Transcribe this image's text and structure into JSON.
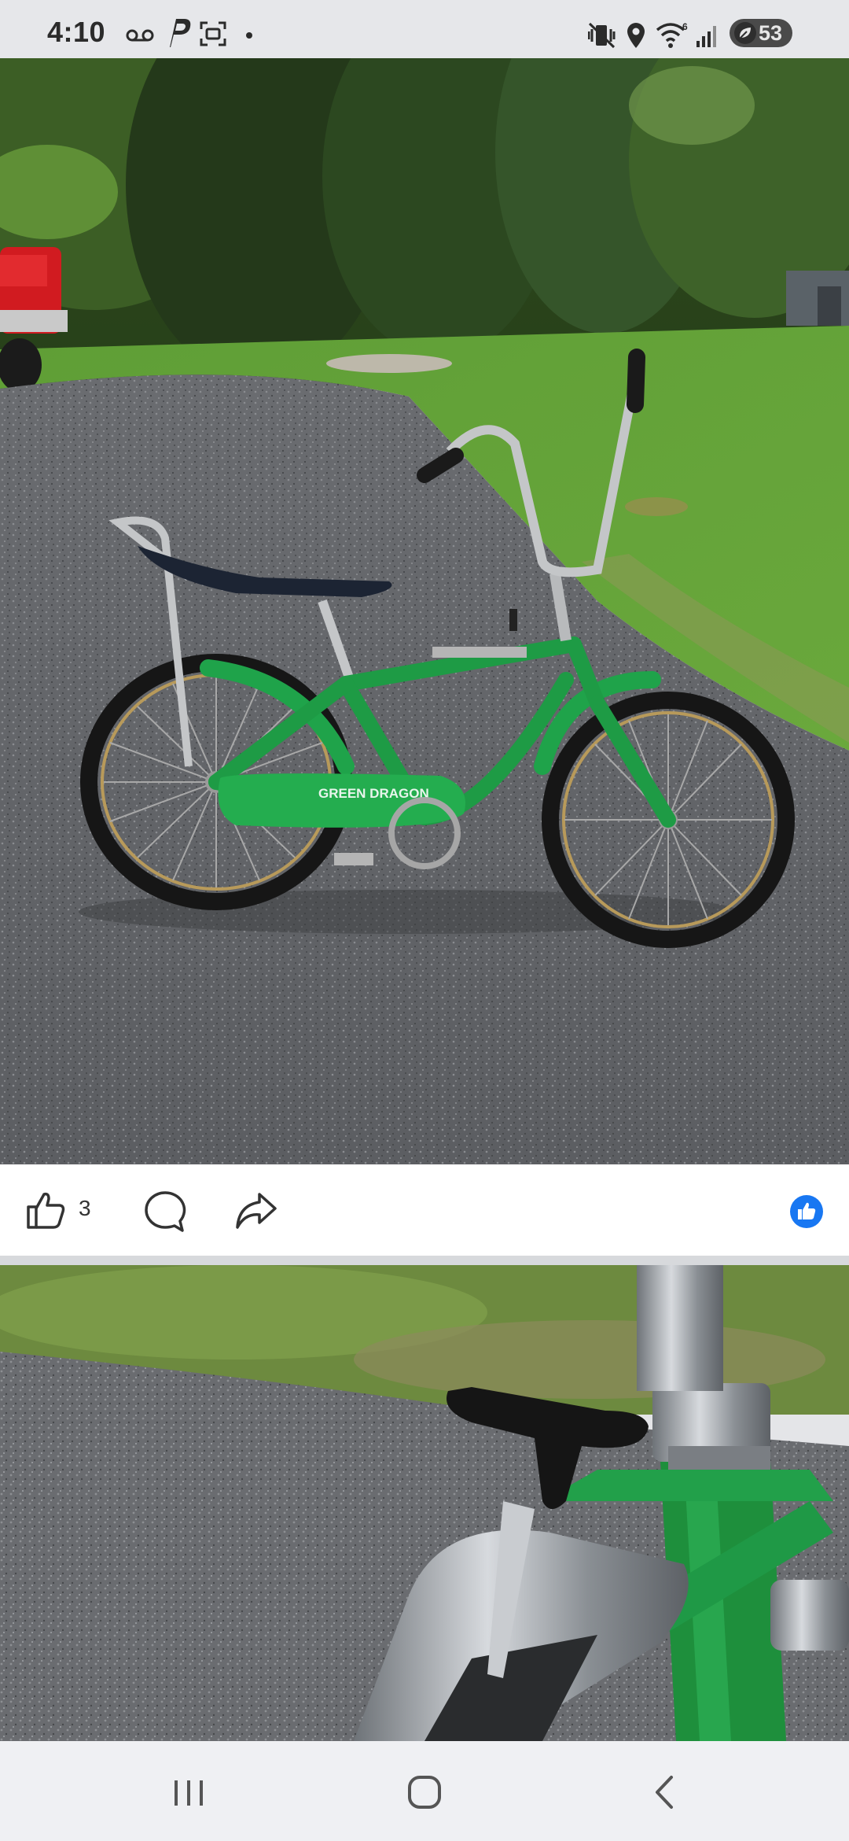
{
  "status_bar": {
    "time": "4:10",
    "left_icons": [
      "voicemail-icon",
      "parking-app-icon",
      "screenshot-icon",
      "dot-icon"
    ],
    "right_icons": [
      "vibrate-mute-icon",
      "location-icon",
      "wifi-6-icon",
      "signal-icon",
      "battery-icon"
    ],
    "battery_level": "53"
  },
  "post": {
    "photo_1": {
      "description_icon": "green-dragon-bicycle-photo",
      "frame_decal": "GREEN DRAGON"
    },
    "reactions": {
      "like_count": "3",
      "like_icon": "thumbs-up-icon",
      "comment_icon": "comment-icon",
      "share_icon": "share-icon",
      "reaction_badge_icon": "like-badge-icon",
      "badge_color": "#1877f2"
    },
    "photo_2": {
      "description_icon": "bicycle-shifter-closeup-photo"
    }
  },
  "nav_bar": {
    "recents_icon": "recents-icon",
    "home_icon": "home-icon",
    "back_icon": "back-icon"
  }
}
